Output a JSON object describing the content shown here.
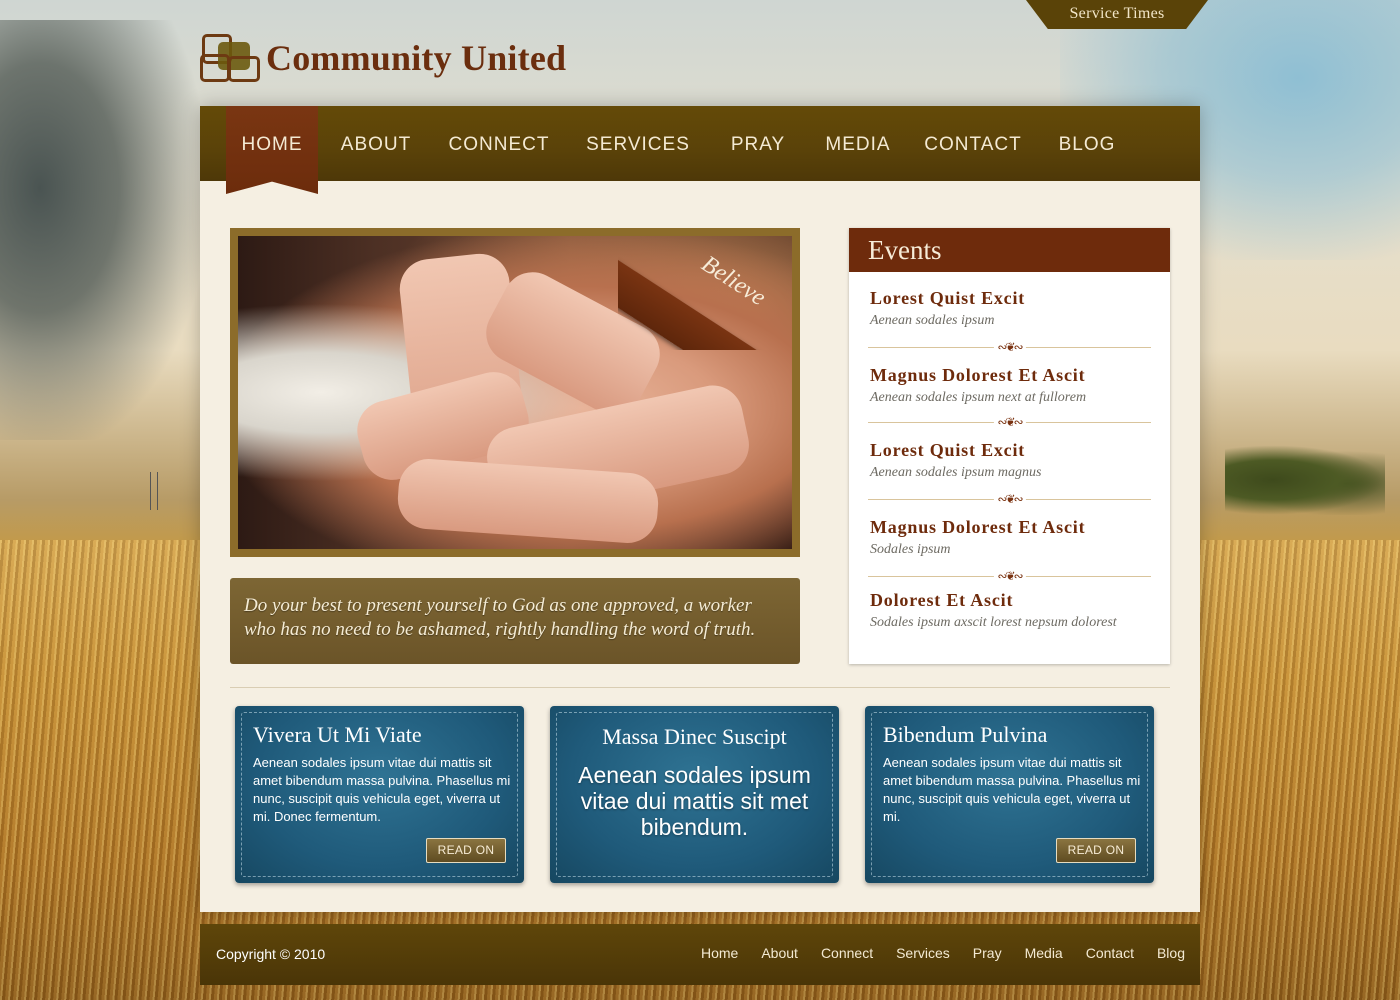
{
  "header": {
    "service_times": "Service Times",
    "logo_title": "Community United"
  },
  "nav": {
    "items": [
      {
        "label": "HOME",
        "active": true
      },
      {
        "label": "ABOUT"
      },
      {
        "label": "CONNECT"
      },
      {
        "label": "SERVICES"
      },
      {
        "label": "PRAY"
      },
      {
        "label": "MEDIA"
      },
      {
        "label": "CONTACT"
      },
      {
        "label": "BLOG"
      }
    ]
  },
  "hero": {
    "ribbon": "Believe",
    "quote": "Do your best to present yourself to God as one approved, a worker who has no need to be ashamed, rightly handling the word of truth."
  },
  "events": {
    "heading": "Events",
    "items": [
      {
        "title": "Lorest Quist Excit",
        "sub": "Aenean sodales ipsum"
      },
      {
        "title": "Magnus Dolorest Et Ascit",
        "sub": "Aenean sodales ipsum next at fullorem"
      },
      {
        "title": "Lorest Quist Excit",
        "sub": "Aenean sodales ipsum magnus"
      },
      {
        "title": "Magnus Dolorest Et Ascit",
        "sub": "Sodales ipsum"
      },
      {
        "title": "Dolorest Et Ascit",
        "sub": "Sodales ipsum axscit lorest nepsum dolorest"
      }
    ]
  },
  "boxes": [
    {
      "title": "Vivera Ut Mi Viate",
      "body": "Aenean sodales ipsum vitae dui mattis sit amet bibendum massa pulvina. Phasellus mi nunc, suscipit quis vehicula eget, viverra ut mi. Donec fermentum.",
      "button": "READ ON"
    },
    {
      "title": "Massa Dinec Suscipt",
      "body": "Aenean sodales ipsum vitae dui mattis sit met bibendum."
    },
    {
      "title": "Bibendum Pulvina",
      "body": "Aenean sodales ipsum vitae dui mattis sit amet bibendum massa pulvina. Phasellus mi nunc, suscipit quis vehicula eget, viverra ut mi.",
      "button": "READ ON"
    }
  ],
  "footer": {
    "copyright": "Copyright © 2010",
    "links": [
      "Home",
      "About",
      "Connect",
      "Services",
      "Pray",
      "Media",
      "Contact",
      "Blog"
    ]
  },
  "colors": {
    "nav_brown": "#5a4209",
    "accent_red_brown": "#6e2b0c",
    "box_blue": "#1f5a7a",
    "page_cream": "#f5efe2"
  }
}
